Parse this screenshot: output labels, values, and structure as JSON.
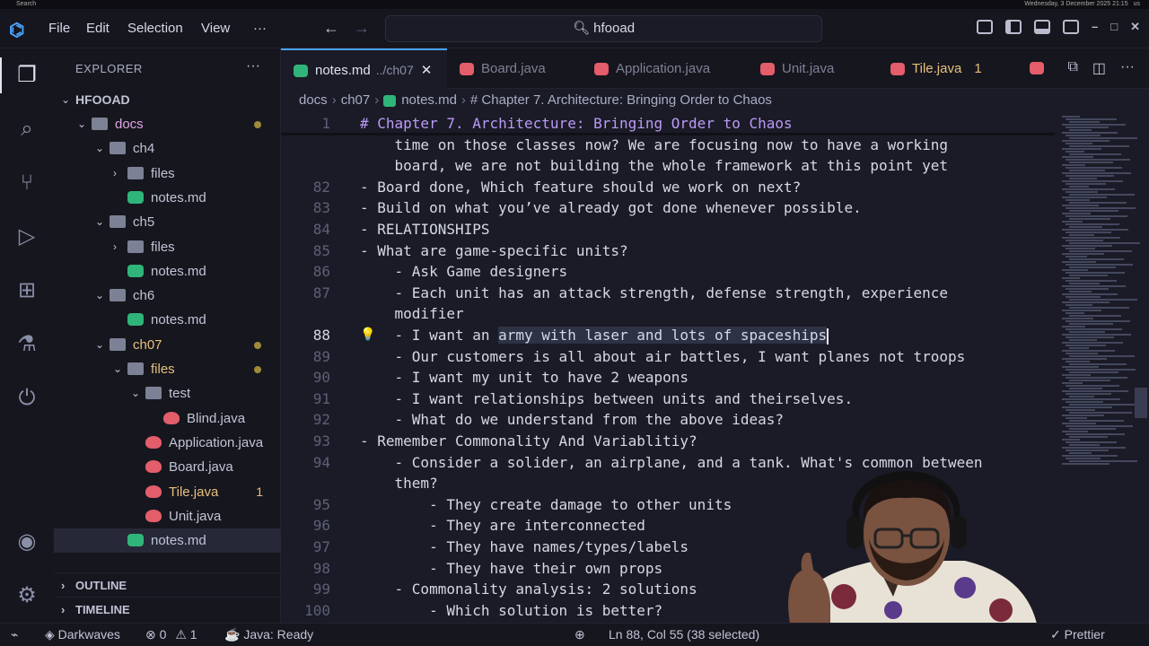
{
  "system_bar": {
    "left": "Search",
    "clock": "Wednesday, 3 December 2025 21:15",
    "locale": "us"
  },
  "menubar": {
    "items": [
      "File",
      "Edit",
      "Selection",
      "View",
      "···"
    ],
    "search_text": "hfooad"
  },
  "sidebar": {
    "title": "EXPLORER",
    "more": "···",
    "root": "HFOOAD",
    "tree": [
      {
        "label": "docs",
        "depth": 1,
        "kind": "folder",
        "open": true,
        "style": "docs",
        "dot": true
      },
      {
        "label": "ch4",
        "depth": 2,
        "kind": "folder",
        "open": true
      },
      {
        "label": "files",
        "depth": 3,
        "kind": "folder",
        "open": false
      },
      {
        "label": "notes.md",
        "depth": 3,
        "kind": "md"
      },
      {
        "label": "ch5",
        "depth": 2,
        "kind": "folder",
        "open": true
      },
      {
        "label": "files",
        "depth": 3,
        "kind": "folder",
        "open": false
      },
      {
        "label": "notes.md",
        "depth": 3,
        "kind": "md"
      },
      {
        "label": "ch6",
        "depth": 2,
        "kind": "folder",
        "open": true
      },
      {
        "label": "notes.md",
        "depth": 3,
        "kind": "md"
      },
      {
        "label": "ch07",
        "depth": 2,
        "kind": "folder",
        "open": true,
        "style": "mod",
        "dot": true
      },
      {
        "label": "files",
        "depth": 3,
        "kind": "folder",
        "open": true,
        "style": "mod",
        "dot": true
      },
      {
        "label": "test",
        "depth": 4,
        "kind": "folder",
        "open": true
      },
      {
        "label": "Blind.java",
        "depth": 5,
        "kind": "java"
      },
      {
        "label": "Application.java",
        "depth": 4,
        "kind": "java"
      },
      {
        "label": "Board.java",
        "depth": 4,
        "kind": "java"
      },
      {
        "label": "Tile.java",
        "depth": 4,
        "kind": "java",
        "style": "mod",
        "badge": "1"
      },
      {
        "label": "Unit.java",
        "depth": 4,
        "kind": "java"
      },
      {
        "label": "notes.md",
        "depth": 3,
        "kind": "md",
        "selected": true
      }
    ],
    "outline": "OUTLINE",
    "timeline": "TIMELINE"
  },
  "tabs": [
    {
      "label": "notes.md",
      "path": "../ch07",
      "kind": "md",
      "active": true
    },
    {
      "label": "Board.java",
      "kind": "java"
    },
    {
      "label": "Application.java",
      "kind": "java"
    },
    {
      "label": "Unit.java",
      "kind": "java"
    },
    {
      "label": "Tile.java",
      "kind": "java",
      "modified": true,
      "badge": "1"
    }
  ],
  "breadcrumb": [
    "docs",
    "ch07",
    "notes.md",
    "# Chapter 7. Architecture: Bringing Order to Chaos"
  ],
  "editor": {
    "lines": [
      {
        "n": "1",
        "text": "# Chapter 7. Architecture: Bringing Order to Chaos",
        "heading": true
      },
      {
        "n": "",
        "text": "    time on those classes now? We are focusing now to have a working"
      },
      {
        "n": "",
        "text": "    board, we are not building the whole framework at this point yet"
      },
      {
        "n": "82",
        "text": "- Board done, Which feature should we work on next?"
      },
      {
        "n": "83",
        "text": "- Build on what you’ve already got done whenever possible."
      },
      {
        "n": "84",
        "text": "- RELATIONSHIPS"
      },
      {
        "n": "85",
        "text": "- What are game-specific units?"
      },
      {
        "n": "86",
        "text": "    - Ask Game designers"
      },
      {
        "n": "87",
        "text": "    - Each unit has an attack strength, defense strength, experience"
      },
      {
        "n": "",
        "text": "    modifier"
      },
      {
        "n": "88",
        "text_before": "    - I want an ",
        "text_sel": "army with laser and lots of spaceships",
        "current": true
      },
      {
        "n": "89",
        "text": "    - Our customers is all about air battles, I want planes not troops"
      },
      {
        "n": "90",
        "text": "    - I want my unit to have 2 weapons"
      },
      {
        "n": "91",
        "text": "    - I want relationships between units and theirselves."
      },
      {
        "n": "92",
        "text": "    - What do we understand from the above ideas?"
      },
      {
        "n": "93",
        "text": "- Remember Commonality And Variablitiy?"
      },
      {
        "n": "94",
        "text": "    - Consider a solider, an airplane, and a tank. What's common between"
      },
      {
        "n": "",
        "text": "    them?"
      },
      {
        "n": "95",
        "text": "        - They create damage to other units"
      },
      {
        "n": "96",
        "text": "        - They are interconnected"
      },
      {
        "n": "97",
        "text": "        - They have names/types/labels"
      },
      {
        "n": "98",
        "text": "        - They have their own props"
      },
      {
        "n": "99",
        "text": "    - Commonality analysis: 2 solutions"
      },
      {
        "n": "100",
        "text": "        - Which solution is better?"
      }
    ]
  },
  "statusbar": {
    "remote": "⌁",
    "theme": "Darkwaves",
    "errors": "0",
    "warnings": "1",
    "java": "Java: Ready",
    "position": "Ln 88, Col 55 (38 selected)",
    "prettier": "Prettier"
  },
  "colors": {
    "accent": "#4aa3ff",
    "heading": "#bb9af7",
    "modified": "#e6c07b",
    "markdown_icon": "#2fb57a",
    "java_icon": "#e35d6a"
  }
}
